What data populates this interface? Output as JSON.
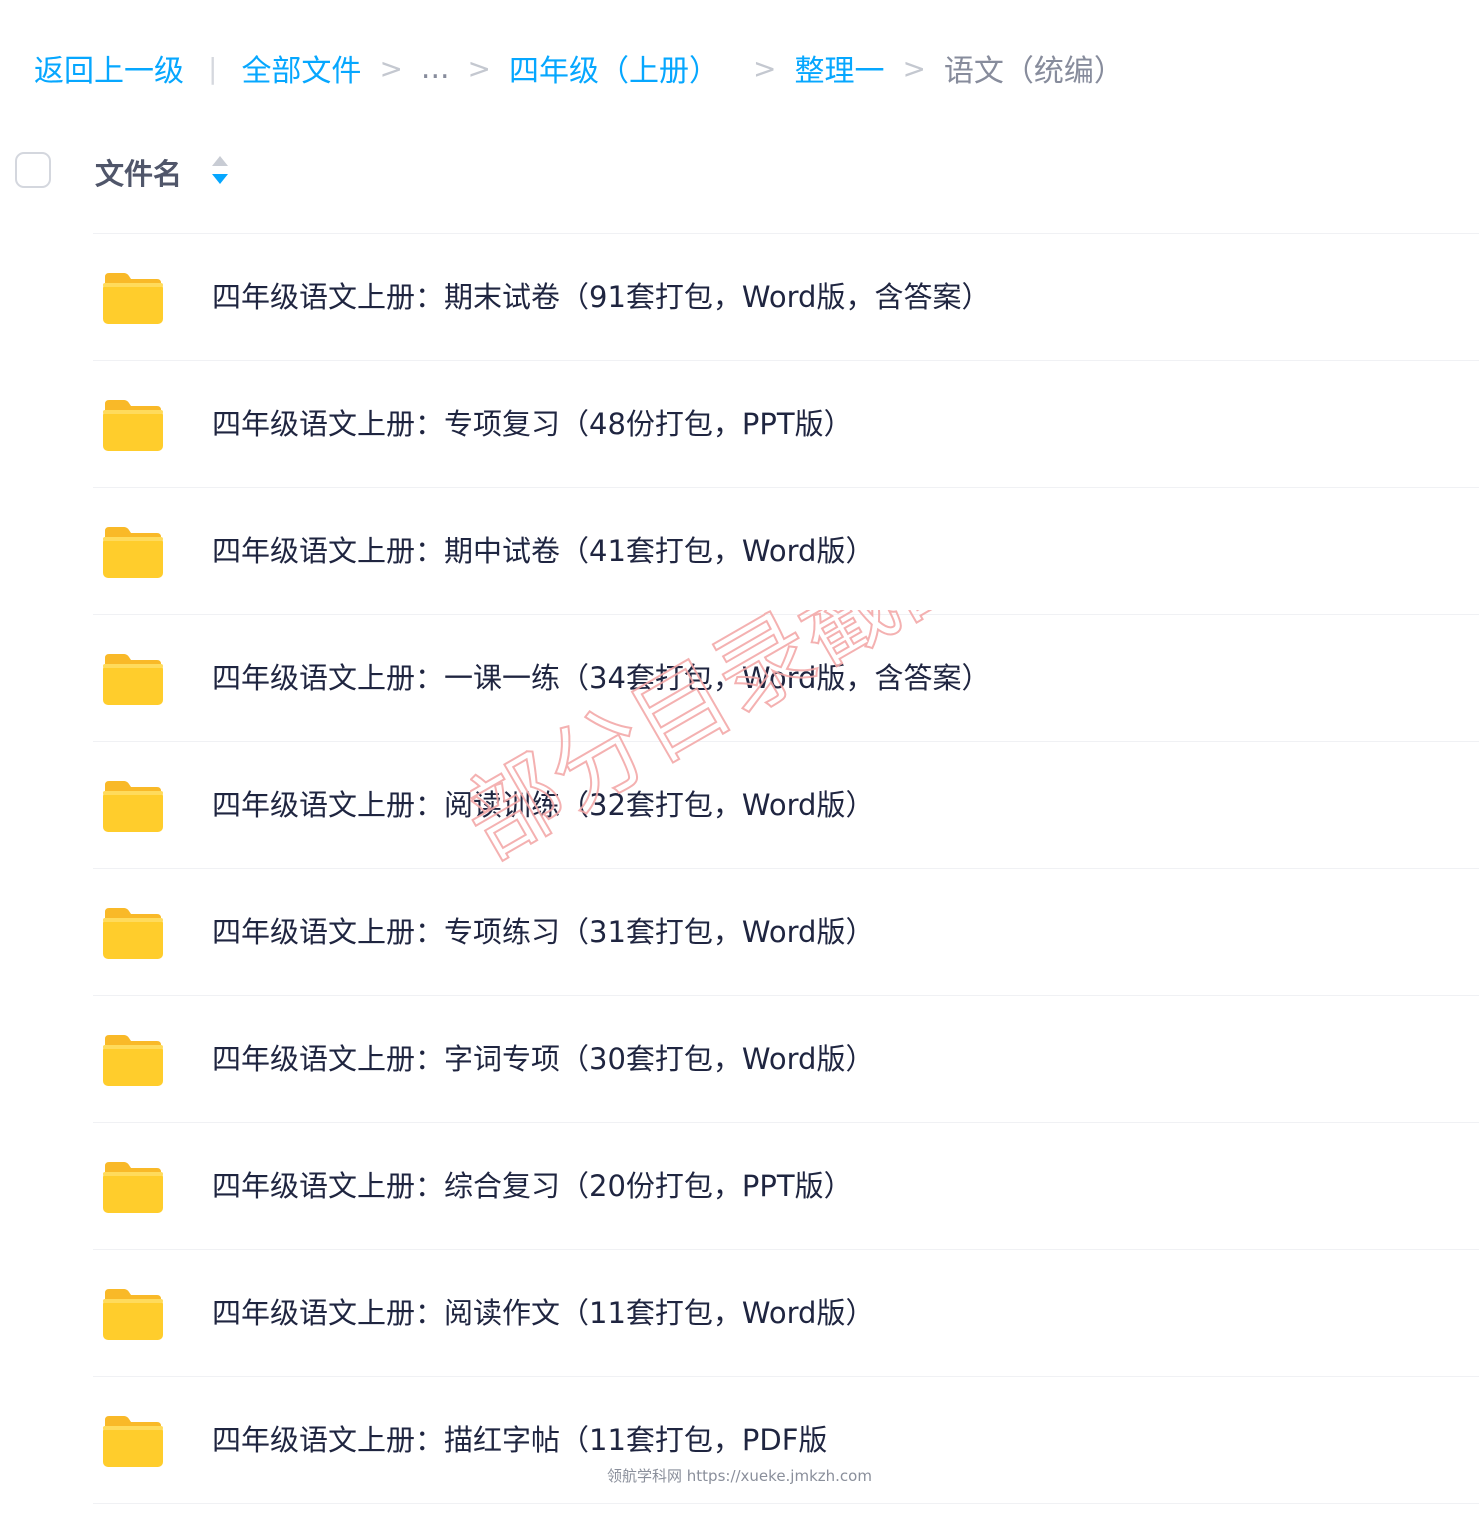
{
  "breadcrumb": {
    "back": "返回上一级",
    "divider": "|",
    "separator": ">",
    "root": "全部文件",
    "ellipsis": "...",
    "level1": "四年级（上册）",
    "level2": "整理一",
    "current": "语文（统编）"
  },
  "header": {
    "column_name": "文件名"
  },
  "files": [
    {
      "name": "四年级语文上册：期末试卷（91套打包，Word版，含答案）"
    },
    {
      "name": "四年级语文上册：专项复习（48份打包，PPT版）"
    },
    {
      "name": "四年级语文上册：期中试卷（41套打包，Word版）"
    },
    {
      "name": "四年级语文上册：一课一练（34套打包，Word版，含答案）"
    },
    {
      "name": "四年级语文上册：阅读训练（32套打包，Word版）"
    },
    {
      "name": "四年级语文上册：专项练习（31套打包，Word版）"
    },
    {
      "name": "四年级语文上册：字词专项（30套打包，Word版）"
    },
    {
      "name": "四年级语文上册：综合复习（20份打包，PPT版）"
    },
    {
      "name": "四年级语文上册：阅读作文（11套打包，Word版）"
    },
    {
      "name": "四年级语文上册：描红字帖（11套打包，PDF版"
    }
  ],
  "watermark": "部分目录截图",
  "footer": "领航学科网 https://xueke.jmkzh.com",
  "icons": {
    "folder": "folder-icon",
    "sort": "sort-icon"
  },
  "colors": {
    "link": "#06a7ff",
    "folder": "#ffcd2c",
    "watermark": "#f3a9a9"
  }
}
